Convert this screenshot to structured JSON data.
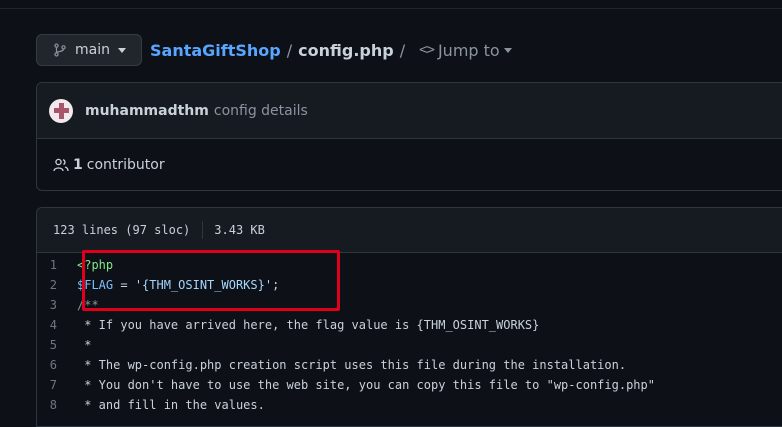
{
  "branch": {
    "label": "main"
  },
  "breadcrumb": {
    "repo": "SantaGiftShop",
    "sep": "/",
    "file": "config.php",
    "sep2": "/",
    "jump": "Jump to"
  },
  "commit": {
    "author": "muhammadthm",
    "message": "config details"
  },
  "contributors": {
    "count": "1",
    "label": "contributor"
  },
  "file": {
    "lines": "123 lines (97 sloc)",
    "size": "3.43 KB"
  },
  "code_lines": [
    {
      "num": "1",
      "text": "<?php"
    },
    {
      "num": "2",
      "var": "$FLAG",
      "op": " = ",
      "str": "'{THM_OSINT_WORKS}'",
      "end": ";"
    },
    {
      "num": "3",
      "text": "/**"
    },
    {
      "num": "4",
      "text": " * If you have arrived here, the flag value is {THM_OSINT_WORKS}"
    },
    {
      "num": "5",
      "text": " *"
    },
    {
      "num": "6",
      "text": " * The wp-config.php creation script uses this file during the installation."
    },
    {
      "num": "7",
      "text": " * You don't have to use the web site, you can copy this file to \"wp-config.php\""
    },
    {
      "num": "8",
      "text": " * and fill in the values."
    }
  ],
  "colors": {
    "highlight": "#e0001b",
    "link": "#58a6ff",
    "background": "#0d1117"
  }
}
